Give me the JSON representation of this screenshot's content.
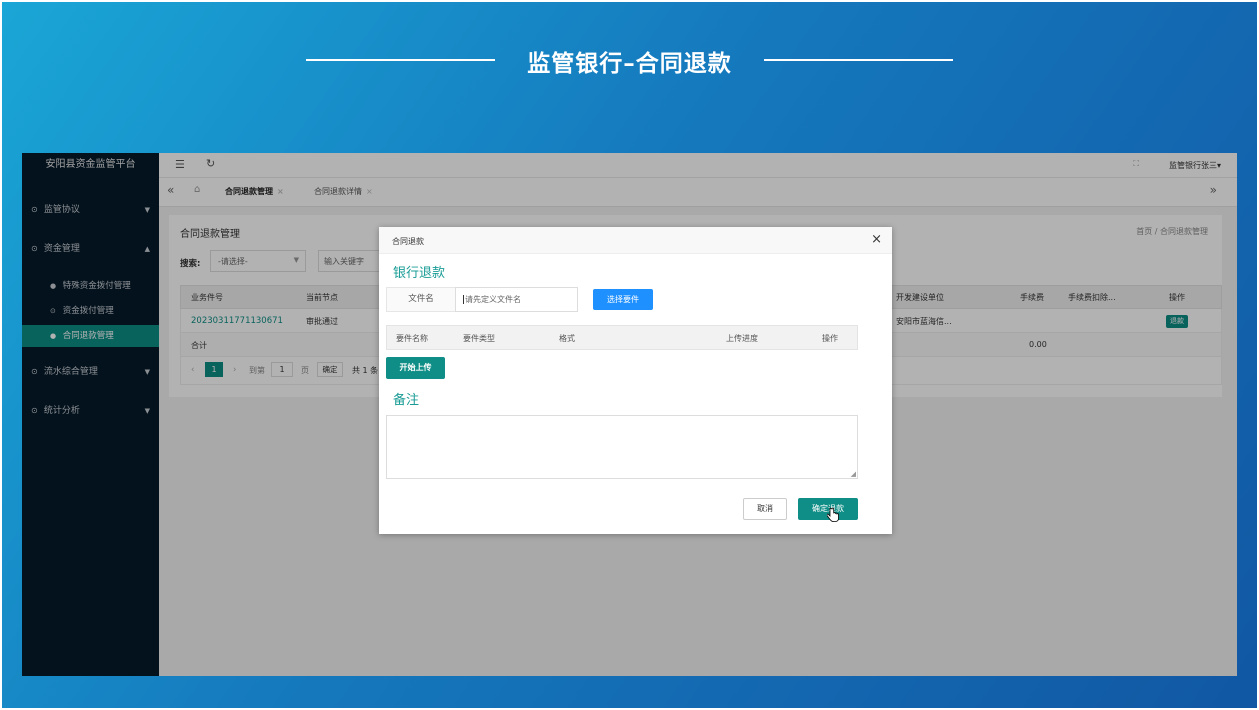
{
  "slide": {
    "title": "监管银行–合同退款"
  },
  "sidebar": {
    "brand": "安阳县资金监管平台",
    "groups": [
      {
        "label": "监管协议",
        "icon": "check-circle-icon",
        "arrow": "▼"
      },
      {
        "label": "资金管理",
        "icon": "check-circle-icon",
        "arrow": "▲"
      },
      {
        "label": "流水综合管理",
        "icon": "check-circle-icon",
        "arrow": "▼"
      },
      {
        "label": "统计分析",
        "icon": "check-circle-icon",
        "arrow": "▼"
      }
    ],
    "subitems": [
      {
        "label": "特殊资金拨付管理"
      },
      {
        "label": "资金拨付管理"
      },
      {
        "label": "合同退款管理"
      }
    ]
  },
  "topbar": {
    "user": "监管银行张三▾"
  },
  "tabs": [
    {
      "label": "合同退款管理"
    },
    {
      "label": "合同退款详情"
    }
  ],
  "page": {
    "title": "合同退款管理",
    "breadcrumb_home": "首页",
    "breadcrumb_sep": "/",
    "breadcrumb_current": "合同退款管理",
    "search_label": "搜索:",
    "select_placeholder": "-请选择-",
    "keyword_placeholder": "输入关键字",
    "table": {
      "headers": [
        "业务件号",
        "当前节点",
        "开发建设单位",
        "手续费",
        "手续费扣除...",
        "操作"
      ],
      "row": {
        "id": "20230311771130671",
        "node": "审批通过",
        "developer": "安阳市蓝海信...",
        "action": "退款"
      },
      "total_label": "合计",
      "total_fee": "0.00"
    },
    "pagination": {
      "current": "1",
      "goto": "到第",
      "page_input": "1",
      "page_unit": "页",
      "confirm": "确定",
      "total": "共 1 条"
    }
  },
  "modal": {
    "title": "合同退款",
    "section_title": "银行退款",
    "file_label": "文件名",
    "file_placeholder": "请先定义文件名",
    "select_button": "选择要件",
    "table_headers": [
      "要件名称",
      "要件类型",
      "格式",
      "上传进度",
      "操作"
    ],
    "upload_button": "开始上传",
    "remark_title": "备注",
    "cancel_button": "取消",
    "confirm_button": "确定退款"
  },
  "colors": {
    "accent": "#0e8e86",
    "blue_button": "#1e90ff",
    "sidebar": "#061a2a"
  }
}
